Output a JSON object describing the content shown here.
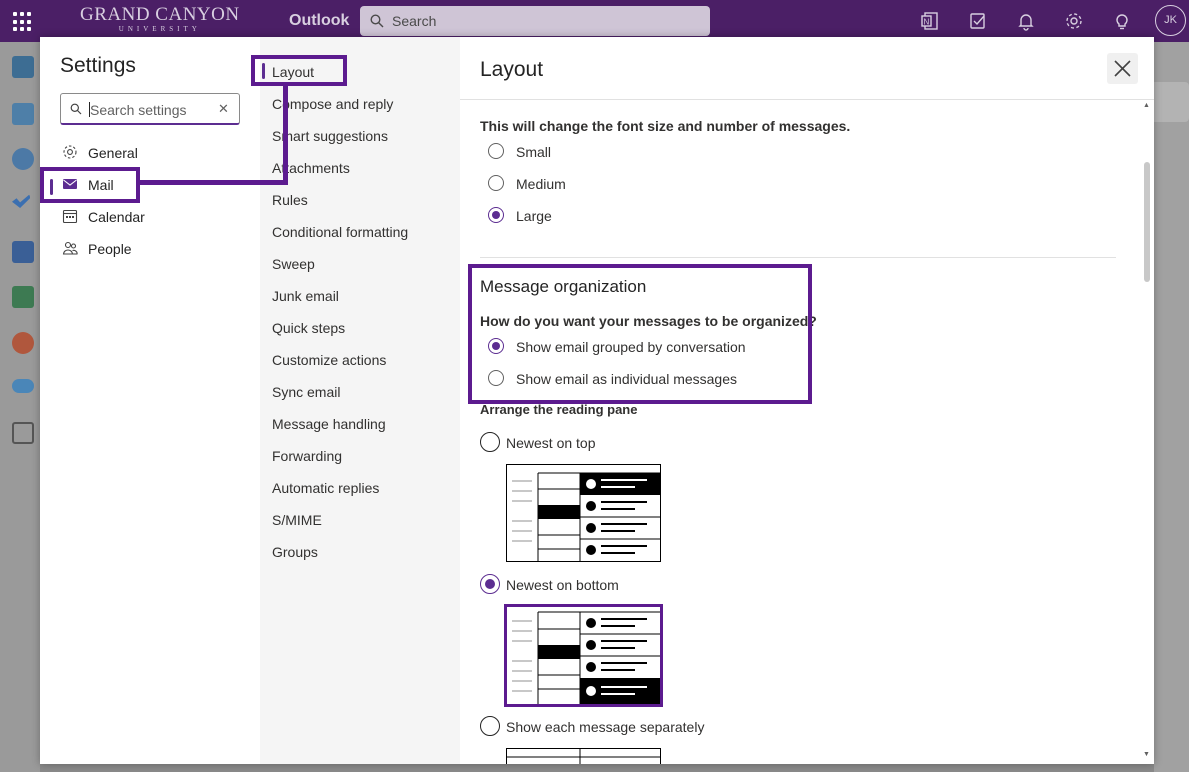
{
  "topbar": {
    "brand_line1": "GRAND CANYON",
    "brand_line2": "UNIVERSITY",
    "app_name": "Outlook",
    "search_placeholder": "Search",
    "avatar_initials": "JK",
    "icons": [
      "onenote-icon",
      "todo-icon",
      "bell-icon",
      "gear-icon",
      "lightbulb-icon"
    ]
  },
  "rail": {
    "icons": [
      "mail-icon",
      "calendar-icon",
      "people-icon",
      "todo-check-icon",
      "word-icon",
      "excel-icon",
      "powerpoint-icon",
      "onedrive-icon",
      "apps-icon"
    ]
  },
  "settings": {
    "title": "Settings",
    "search_placeholder": "Search settings",
    "categories": [
      {
        "label": "General",
        "icon": "gear-icon"
      },
      {
        "label": "Mail",
        "icon": "envelope-icon",
        "selected": true
      },
      {
        "label": "Calendar",
        "icon": "calendar-icon"
      },
      {
        "label": "People",
        "icon": "people-icon"
      }
    ],
    "mail_subitems": [
      "Layout",
      "Compose and reply",
      "Smart suggestions",
      "Attachments",
      "Rules",
      "Conditional formatting",
      "Sweep",
      "Junk email",
      "Quick steps",
      "Customize actions",
      "Sync email",
      "Message handling",
      "Forwarding",
      "Automatic replies",
      "S/MIME",
      "Groups"
    ],
    "selected_subitem": "Layout"
  },
  "layout_pane": {
    "title": "Layout",
    "text_size": {
      "description": "This will change the font size and number of messages.",
      "options": [
        "Small",
        "Medium",
        "Large"
      ],
      "selected": "Large"
    },
    "message_organization": {
      "heading": "Message organization",
      "question": "How do you want your messages to be organized?",
      "options": [
        "Show email grouped by conversation",
        "Show email as individual messages"
      ],
      "selected": "Show email grouped by conversation"
    },
    "reading_pane": {
      "heading": "Arrange the reading pane",
      "options": [
        "Newest on top",
        "Newest on bottom",
        "Show each message separately"
      ],
      "selected": "Newest on bottom"
    }
  },
  "colors": {
    "brand": "#4b1f66",
    "accent": "#5c2d91",
    "highlight": "#5c1b8f"
  }
}
